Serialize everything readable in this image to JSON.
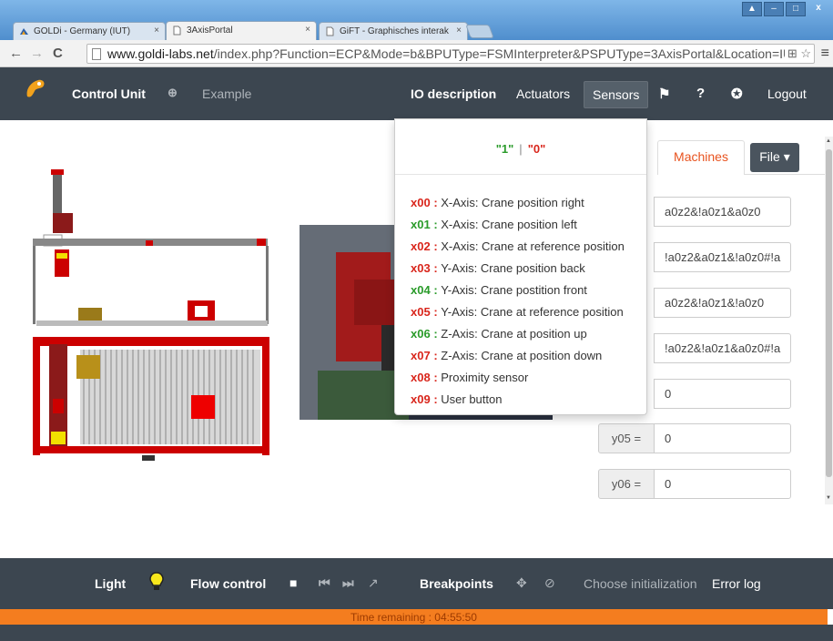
{
  "browser": {
    "tabs": [
      {
        "title": "GOLDi - Germany (IUT)",
        "close": "×"
      },
      {
        "title": "3AxisPortal",
        "close": "×"
      },
      {
        "title": "GiFT - Graphisches interak",
        "close": "×"
      }
    ],
    "url_host": "www.goldi-labs.net",
    "url_path": "/index.php?Function=ECP&Mode=b&BPUType=FSMInterpreter&PSPUType=3AxisPortal&Location=IUT#",
    "window_buttons": {
      "minimize": "–",
      "maximize": "□",
      "close": "x"
    }
  },
  "navbar": {
    "control_unit": "Control Unit",
    "example": "Example",
    "io_description": "IO description",
    "actuators": "Actuators",
    "sensors": "Sensors",
    "logout": "Logout"
  },
  "sensors_dropdown": {
    "legend_one": "\"1\"",
    "legend_sep": "|",
    "legend_zero": "\"0\"",
    "items": [
      {
        "code": "x00",
        "label": "X-Axis: Crane position right",
        "color": "red"
      },
      {
        "code": "x01",
        "label": "X-Axis: Crane position left",
        "color": "green"
      },
      {
        "code": "x02",
        "label": "X-Axis: Crane at reference position",
        "color": "red"
      },
      {
        "code": "x03",
        "label": "Y-Axis: Crane position back",
        "color": "red"
      },
      {
        "code": "x04",
        "label": "Y-Axis: Crane postition front",
        "color": "green"
      },
      {
        "code": "x05",
        "label": "Y-Axis: Crane at reference position",
        "color": "red"
      },
      {
        "code": "x06",
        "label": "Z-Axis: Crane at position up",
        "color": "green"
      },
      {
        "code": "x07",
        "label": "Z-Axis: Crane at position down",
        "color": "red"
      },
      {
        "code": "x08",
        "label": "Proximity sensor",
        "color": "red"
      },
      {
        "code": "x09",
        "label": "User button",
        "color": "red"
      }
    ]
  },
  "right_panel": {
    "machines_tab": "Machines",
    "file_button": "File",
    "expressions": [
      "a0z2&!a0z1&a0z0",
      "!a0z2&a0z1&!a0z0#!a",
      "a0z2&!a0z1&!a0z0",
      "!a0z2&!a0z1&a0z0#!a",
      "0"
    ],
    "outputs": [
      {
        "label": "y05 =",
        "value": "0"
      },
      {
        "label": "y06 =",
        "value": "0"
      }
    ]
  },
  "toolbar": {
    "light": "Light",
    "flow_control": "Flow control",
    "breakpoints": "Breakpoints",
    "choose_initialization": "Choose initialization",
    "error_log": "Error log"
  },
  "timer": {
    "text": "Time remaining : 04:55:50"
  },
  "colors": {
    "navbar_bg": "#3c4650",
    "accent_orange": "#f47d1f",
    "state_one": "#2a9b2a",
    "state_zero": "#d9261c"
  }
}
